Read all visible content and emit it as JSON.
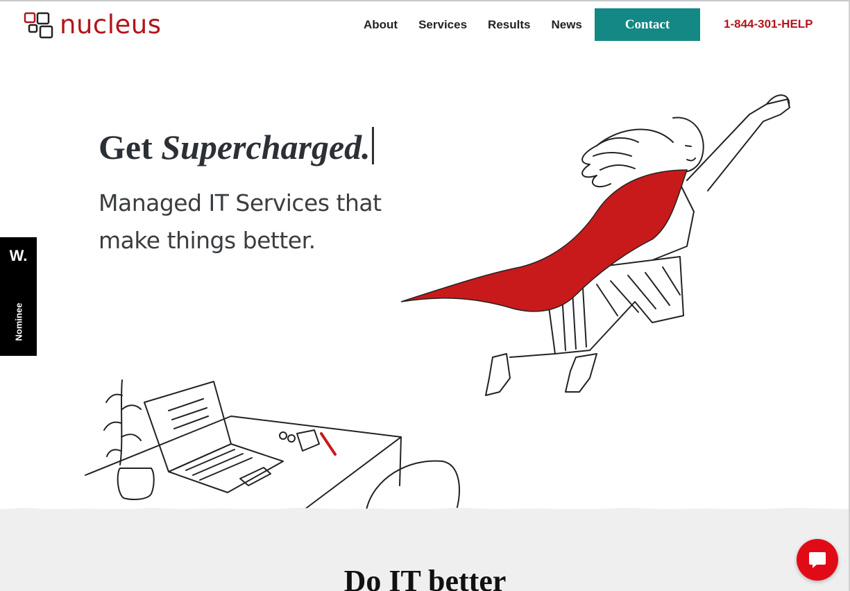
{
  "header": {
    "logo_text": "nucleus",
    "nav": [
      "About",
      "Services",
      "Results",
      "News"
    ],
    "contact_label": "Contact",
    "phone": "1-844-301-HELP"
  },
  "hero": {
    "headline_prefix": "Get ",
    "headline_emphasis": "Supercharged.",
    "subhead": "Managed IT Services that make things better."
  },
  "award": {
    "mark": "W.",
    "label": "Nominee"
  },
  "section": {
    "heading": "Do IT better"
  },
  "icons": {
    "logo": "nucleus-squares-logo-icon",
    "chat": "chat-bubble-icon",
    "hero": "flying-superhero-illustration",
    "desk": "desk-laptop-illustration"
  },
  "colors": {
    "brand_red": "#b3141c",
    "contact_teal": "#148884",
    "chat_red": "#e10b17",
    "cape_red": "#c81a1a",
    "section_bg": "#efefef",
    "text_dark": "#2b3036"
  }
}
